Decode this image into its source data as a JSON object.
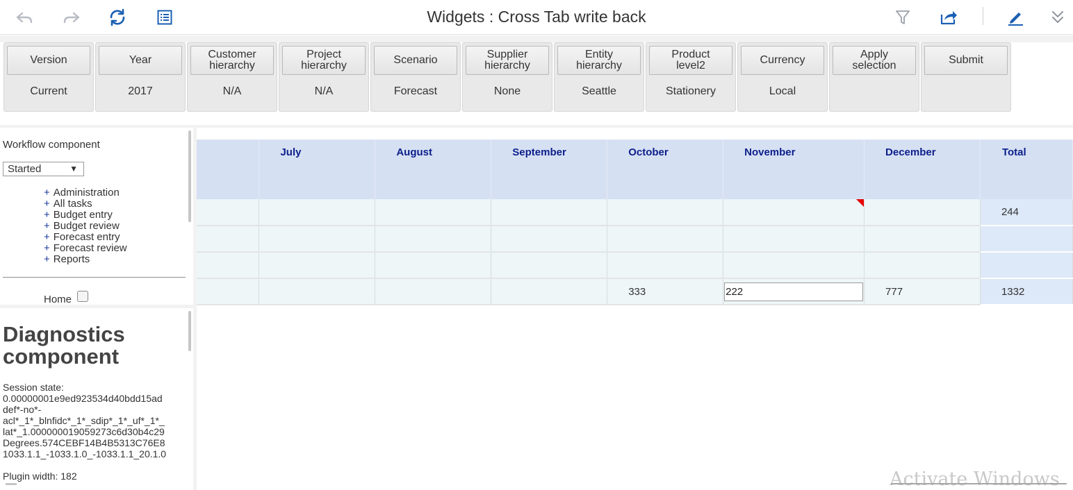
{
  "app": {
    "title": "Widgets : Cross Tab write back"
  },
  "toolbar": {
    "icons": [
      "undo-icon",
      "redo-icon",
      "refresh-icon",
      "list-view-icon",
      "filter-icon",
      "share-icon",
      "edit-pencil-icon",
      "expand-down-icon"
    ],
    "accent_color": "#1a5fb4"
  },
  "filters": [
    {
      "label": "Version",
      "value": "Current"
    },
    {
      "label": "Year",
      "value": "2017"
    },
    {
      "label": "Customer hierarchy",
      "value": "N/A"
    },
    {
      "label": "Project hierarchy",
      "value": "N/A"
    },
    {
      "label": "Scenario",
      "value": "Forecast"
    },
    {
      "label": "Supplier hierarchy",
      "value": "None"
    },
    {
      "label": "Entity hierarchy",
      "value": "Seattle"
    },
    {
      "label": "Product level2",
      "value": "Stationery"
    },
    {
      "label": "Currency",
      "value": "Local"
    },
    {
      "label": "Apply selection",
      "value": ""
    },
    {
      "label": "Submit",
      "value": ""
    }
  ],
  "workflow": {
    "title": "Workflow component",
    "status_selected": "Started",
    "status_arrow": "▼",
    "plus": "+",
    "tasks": [
      "Administration",
      "All tasks",
      "Budget entry",
      "Budget review",
      "Forecast entry",
      "Forecast review",
      "Reports"
    ],
    "home_label": "Home"
  },
  "diagnostics": {
    "title_line1": "Diagnostics",
    "title_line2": "component",
    "session_text": "Session state:\n0.00000001e9ed923534d40bdd15ad\ndef*-no*-\nacl*_1*_blnfidc*_1*_sdip*_1*_uf*_1*_\nlat*_1.000000019059273c6d30b4c29\nDegrees.574CEBF14B4B5313C76E8\n1033.1.1_-1033.1.0_-1033.1.1_20.1.0",
    "plugin_width": "Plugin width: 182"
  },
  "crosstab": {
    "columns": [
      "",
      "July",
      "August",
      "September",
      "October",
      "November",
      "December",
      "Total"
    ],
    "rows": [
      [
        "",
        "",
        "",
        "",
        "",
        "",
        "",
        "244"
      ],
      [
        "",
        "",
        "",
        "",
        "",
        "",
        "",
        ""
      ],
      [
        "",
        "",
        "",
        "",
        "",
        "",
        "",
        ""
      ],
      [
        "",
        "",
        "",
        "",
        "333",
        "222",
        "777",
        "1332"
      ]
    ],
    "header_color": "#d6e0f3",
    "header_text_color": "#0b1f8a",
    "cell_color": "#eef6f8",
    "total_color": "#dde8f8",
    "changed_flag_color": "#e60000"
  },
  "watermark": {
    "text": "Activate Windows"
  }
}
